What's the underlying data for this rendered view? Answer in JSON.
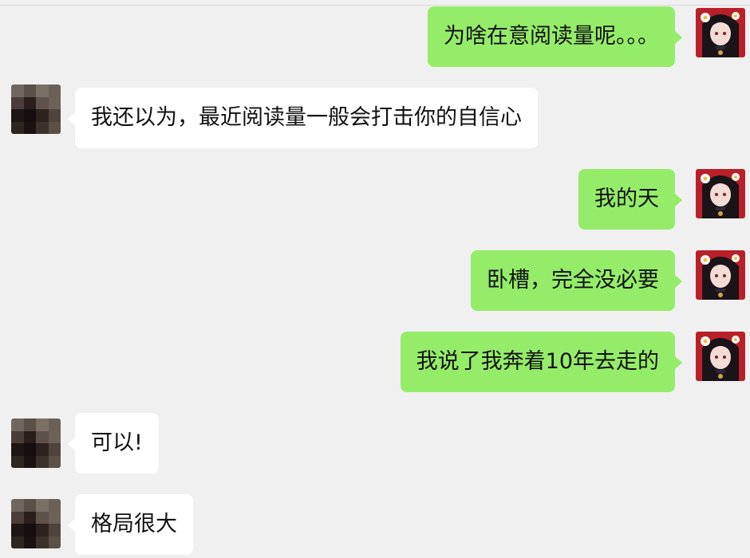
{
  "chat": {
    "messages": [
      {
        "sender": "self",
        "text": "为啥在意阅读量呢。。。"
      },
      {
        "sender": "other",
        "text": "我还以为，最近阅读量一般会打击你的自信心"
      },
      {
        "sender": "self",
        "text": "我的天"
      },
      {
        "sender": "self",
        "text": "卧槽，完全没必要"
      },
      {
        "sender": "self",
        "text": "我说了我奔着10年去走的"
      },
      {
        "sender": "other",
        "text": "可以!"
      },
      {
        "sender": "other",
        "text": "格局很大"
      }
    ]
  },
  "colors": {
    "background": "#f0f0f0",
    "self_bubble": "#95ec69",
    "other_bubble": "#ffffff"
  },
  "avatars": {
    "self": "anime-character-avatar",
    "other": "pixelated-mosaic-avatar"
  }
}
